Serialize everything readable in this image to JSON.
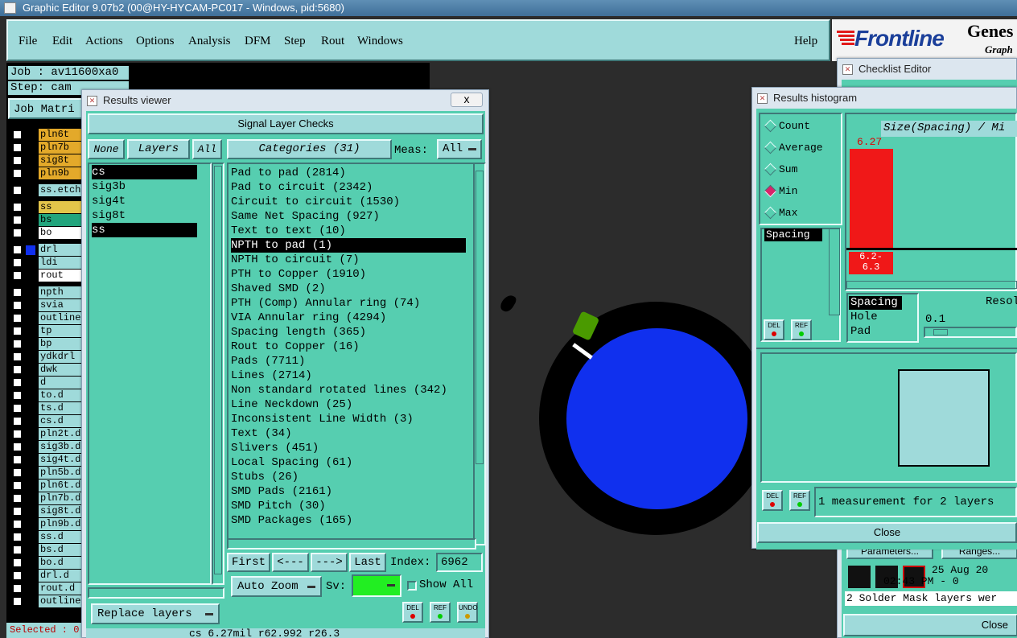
{
  "os_title": "Graphic Editor 9.07b2 (00@HY-HYCAM-PC017 - Windows, pid:5680)",
  "menu": [
    "File",
    "Edit",
    "Actions",
    "Options",
    "Analysis",
    "DFM",
    "Step",
    "Rout",
    "Windows"
  ],
  "help": "Help",
  "brand": {
    "logo": "Frontline",
    "genes": "Genes",
    "sub": "Graph"
  },
  "job": {
    "job_label": "Job : av11600xa0",
    "step_label": "Step: cam",
    "matrix_label": "Job Matri"
  },
  "layers": [
    {
      "name": "pln6t",
      "color": "#e3a92a"
    },
    {
      "name": "pln7b",
      "color": "#e3a92a"
    },
    {
      "name": "sig8t",
      "color": "#e3a92a"
    },
    {
      "name": "pln9b",
      "color": "#e3a92a"
    },
    {
      "name": "ss.etch",
      "color": "#9fdada"
    },
    {
      "name": "ss",
      "color": "#e3c54a"
    },
    {
      "name": "bs",
      "color": "#22a57d"
    },
    {
      "name": "bo",
      "color": "#ffffff"
    },
    {
      "name": "drl",
      "color": "#9fdada",
      "marker": "#1030ee"
    },
    {
      "name": "ldi",
      "color": "#9fdada"
    },
    {
      "name": "rout",
      "color": "#ffffff"
    },
    {
      "name": "npth",
      "color": "#9fdada"
    },
    {
      "name": "svia",
      "color": "#9fdada"
    },
    {
      "name": "outline",
      "color": "#9fdada"
    },
    {
      "name": "tp",
      "color": "#9fdada"
    },
    {
      "name": "bp",
      "color": "#9fdada"
    },
    {
      "name": "ydkdrl",
      "color": "#9fdada"
    },
    {
      "name": "dwk",
      "color": "#9fdada"
    },
    {
      "name": "d",
      "color": "#9fdada"
    },
    {
      "name": "to.d",
      "color": "#9fdada"
    },
    {
      "name": "ts.d",
      "color": "#9fdada"
    },
    {
      "name": "cs.d",
      "color": "#9fdada"
    },
    {
      "name": "pln2t.d",
      "color": "#9fdada"
    },
    {
      "name": "sig3b.d",
      "color": "#9fdada"
    },
    {
      "name": "sig4t.d",
      "color": "#9fdada"
    },
    {
      "name": "pln5b.d",
      "color": "#9fdada"
    },
    {
      "name": "pln6t.d",
      "color": "#9fdada"
    },
    {
      "name": "pln7b.d",
      "color": "#9fdada"
    },
    {
      "name": "sig8t.d",
      "color": "#9fdada"
    },
    {
      "name": "pln9b.d",
      "color": "#9fdada"
    },
    {
      "name": "ss.d",
      "color": "#9fdada"
    },
    {
      "name": "bs.d",
      "color": "#9fdada"
    },
    {
      "name": "bo.d",
      "color": "#9fdada"
    },
    {
      "name": "drl.d",
      "color": "#9fdada"
    },
    {
      "name": "rout.d",
      "color": "#9fdada"
    },
    {
      "name": "outline",
      "color": "#9fdada"
    }
  ],
  "selected": "Selected : 0",
  "results_viewer": {
    "title": "Results viewer",
    "close": "x",
    "header": "Signal Layer Checks",
    "none": "None",
    "layers_label": "Layers",
    "all": "All",
    "categories_label": "Categories (31)",
    "meas_label": "Meas:",
    "meas_value": "All",
    "layer_list": [
      {
        "name": "cs",
        "selected": true
      },
      {
        "name": "sig3b",
        "selected": false
      },
      {
        "name": "sig4t",
        "selected": false
      },
      {
        "name": "sig8t",
        "selected": false
      },
      {
        "name": "ss",
        "selected": true
      }
    ],
    "categories": [
      {
        "text": "Pad to pad (2814)",
        "selected": false
      },
      {
        "text": "Pad to circuit (2342)",
        "selected": false
      },
      {
        "text": "Circuit to circuit (1530)",
        "selected": false
      },
      {
        "text": "Same Net Spacing (927)",
        "selected": false
      },
      {
        "text": "Text to text (10)",
        "selected": false
      },
      {
        "text": "NPTH to pad (1)",
        "selected": true
      },
      {
        "text": "NPTH to circuit (7)",
        "selected": false
      },
      {
        "text": "PTH to Copper (1910)",
        "selected": false
      },
      {
        "text": "Shaved SMD (2)",
        "selected": false
      },
      {
        "text": "PTH (Comp) Annular ring (74)",
        "selected": false
      },
      {
        "text": "VIA Annular ring (4294)",
        "selected": false
      },
      {
        "text": "Spacing length (365)",
        "selected": false
      },
      {
        "text": "Rout to Copper (16)",
        "selected": false
      },
      {
        "text": "Pads (7711)",
        "selected": false
      },
      {
        "text": "Lines (2714)",
        "selected": false
      },
      {
        "text": "Non standard rotated lines (342)",
        "selected": false
      },
      {
        "text": "Line Neckdown (25)",
        "selected": false
      },
      {
        "text": "Inconsistent Line Width (3)",
        "selected": false
      },
      {
        "text": "Text (34)",
        "selected": false
      },
      {
        "text": "Slivers (451)",
        "selected": false
      },
      {
        "text": "Local Spacing (61)",
        "selected": false
      },
      {
        "text": "Stubs (26)",
        "selected": false
      },
      {
        "text": "SMD Pads (2161)",
        "selected": false
      },
      {
        "text": "SMD Pitch (30)",
        "selected": false
      },
      {
        "text": "SMD Packages (165)",
        "selected": false
      }
    ],
    "first": "First",
    "prev": "<---",
    "next": "--->",
    "last": "Last",
    "index_label": "Index:",
    "index_value": "6962",
    "auto_zoom": "Auto Zoom",
    "sv_label": "Sv:",
    "show_all": "Show All",
    "replace_layers": "Replace layers",
    "status": "cs 6.27mil  r62.992  r26.3",
    "del": "DEL",
    "ref": "REF",
    "undo": "UNDO"
  },
  "histogram": {
    "title": "Results histogram",
    "modes": [
      {
        "label": "Count",
        "on": false
      },
      {
        "label": "Average",
        "on": false
      },
      {
        "label": "Sum",
        "on": false
      },
      {
        "label": "Min",
        "on": true
      },
      {
        "label": "Max",
        "on": false
      }
    ],
    "chart_title": "Size(Spacing) / Mi",
    "bar_value": "6.27",
    "range_label": "6.2-\n6.3",
    "spacing_list": [
      "Spacing"
    ],
    "type_list": [
      "Spacing",
      "Hole",
      "Pad"
    ],
    "resolution_label": "Resol",
    "resolution_value": "0.1",
    "measurement_text": "1 measurement for 2 layers",
    "close": "Close",
    "del": "DEL",
    "ref": "REF"
  },
  "checklist": {
    "title": "Checklist Editor",
    "parameters": "Parameters...",
    "ranges": "Ranges...",
    "date": "25 Aug 20",
    "time": "02:43 PM - 0",
    "message": "2 Solder Mask layers wer",
    "close": "Close"
  }
}
